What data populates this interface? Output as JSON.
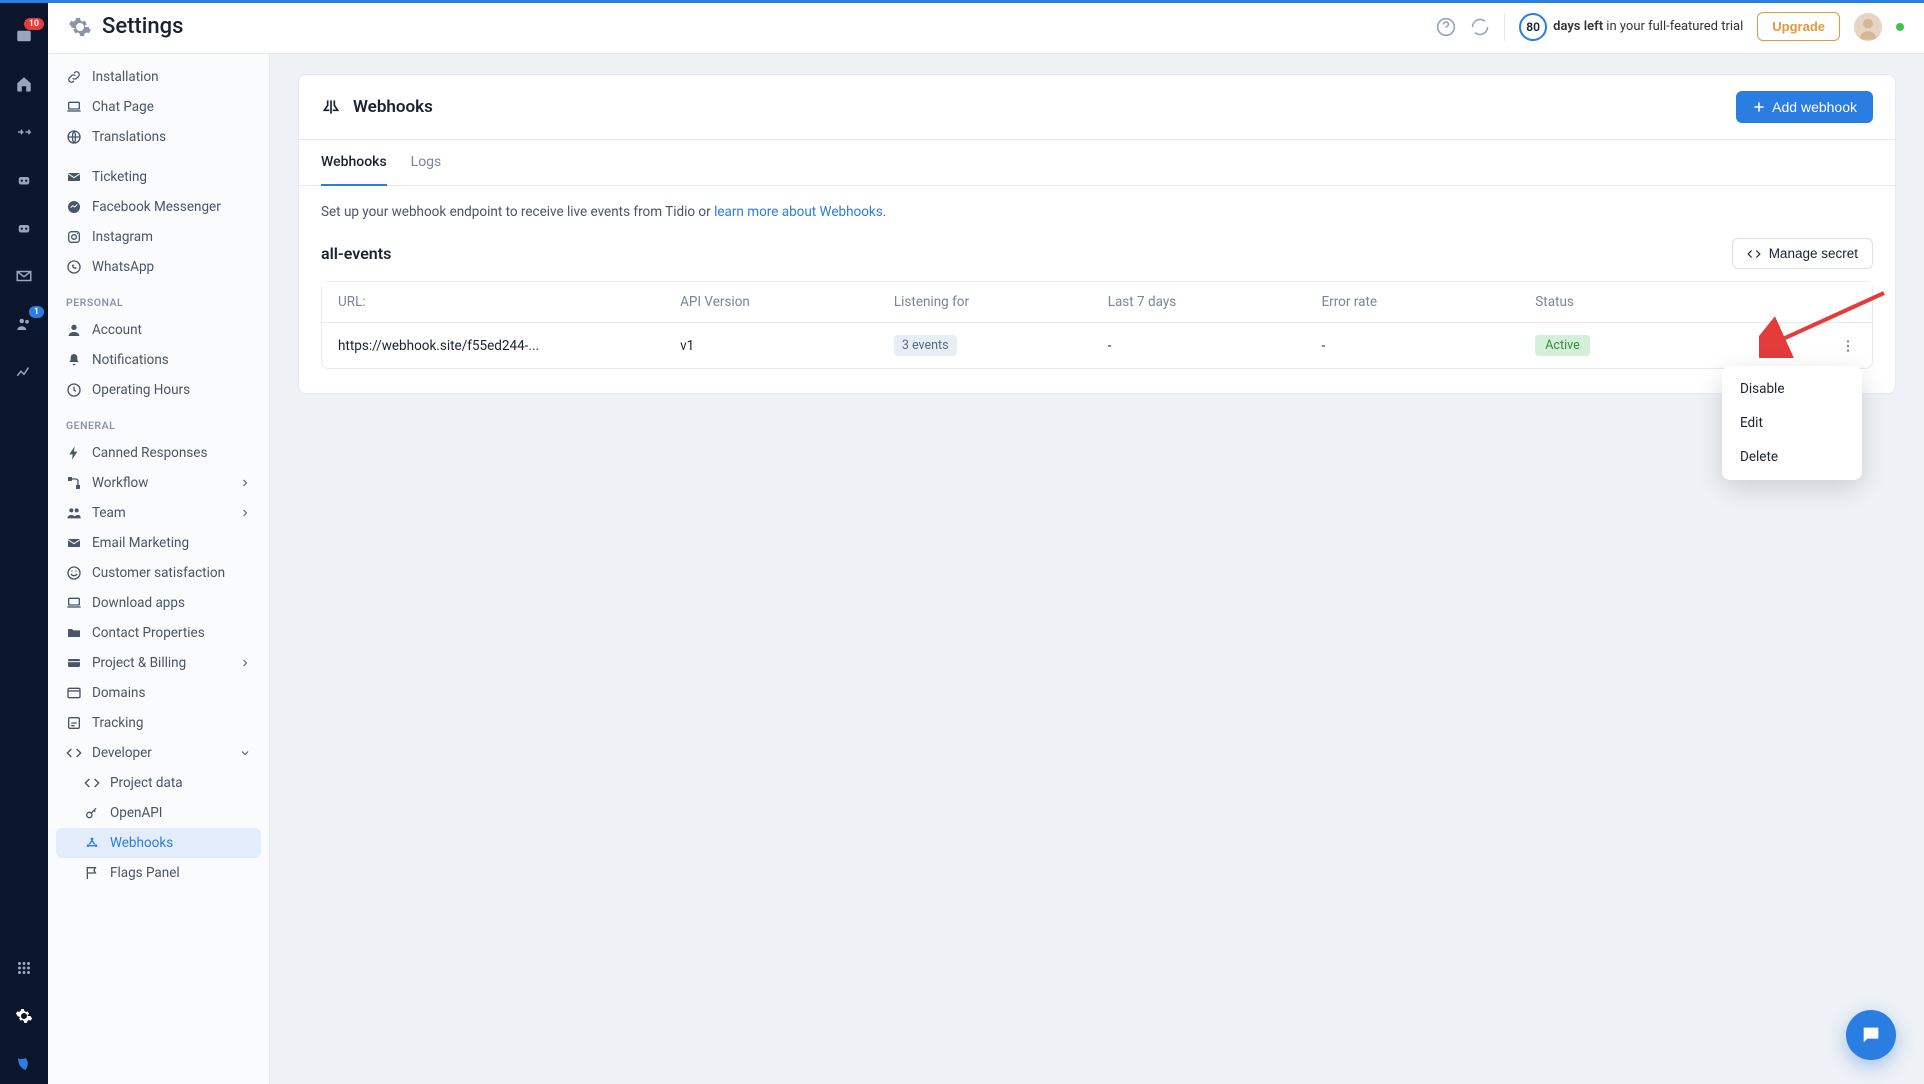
{
  "header": {
    "title": "Settings",
    "trial": {
      "days": "80",
      "text_bold": "days left",
      "text_rest": " in your full-featured trial"
    },
    "upgrade_label": "Upgrade"
  },
  "rail": {
    "badge_inbox": "10",
    "badge_team": "1"
  },
  "sidebar": {
    "items": [
      {
        "label": "Installation",
        "icon": "link"
      },
      {
        "label": "Chat Page",
        "icon": "laptop"
      },
      {
        "label": "Translations",
        "icon": "globe"
      }
    ],
    "channels": [
      {
        "label": "Ticketing",
        "icon": "mail"
      },
      {
        "label": "Facebook Messenger",
        "icon": "messenger"
      },
      {
        "label": "Instagram",
        "icon": "instagram"
      },
      {
        "label": "WhatsApp",
        "icon": "whatsapp"
      }
    ],
    "personal_label": "PERSONAL",
    "personal": [
      {
        "label": "Account",
        "icon": "user"
      },
      {
        "label": "Notifications",
        "icon": "bell"
      },
      {
        "label": "Operating Hours",
        "icon": "clock"
      }
    ],
    "general_label": "GENERAL",
    "general": [
      {
        "label": "Canned Responses",
        "icon": "bolt"
      },
      {
        "label": "Workflow",
        "icon": "workflow",
        "chevron": true
      },
      {
        "label": "Team",
        "icon": "team",
        "chevron": true
      },
      {
        "label": "Email Marketing",
        "icon": "mail"
      },
      {
        "label": "Customer satisfaction",
        "icon": "smile"
      },
      {
        "label": "Download apps",
        "icon": "laptop"
      },
      {
        "label": "Contact Properties",
        "icon": "folder"
      },
      {
        "label": "Project & Billing",
        "icon": "billing",
        "chevron": true
      },
      {
        "label": "Domains",
        "icon": "domains"
      },
      {
        "label": "Tracking",
        "icon": "tracking"
      },
      {
        "label": "Developer",
        "icon": "code",
        "chevron_down": true
      }
    ],
    "developer_sub": [
      {
        "label": "Project data",
        "icon": "code"
      },
      {
        "label": "OpenAPI",
        "icon": "key"
      },
      {
        "label": "Webhooks",
        "icon": "webhook",
        "active": true
      }
    ],
    "flags": {
      "label": "Flags Panel",
      "icon": "flags"
    }
  },
  "page": {
    "title": "Webhooks",
    "add_button": "Add webhook",
    "tabs": [
      {
        "label": "Webhooks",
        "active": true
      },
      {
        "label": "Logs",
        "active": false
      }
    ],
    "intro_prefix": "Set up your webhook endpoint to receive live events from Tidio or ",
    "intro_link": "learn more about Webhooks",
    "section_name": "all-events",
    "manage_secret_label": "Manage secret",
    "table": {
      "headers": [
        "URL:",
        "API Version",
        "Listening for",
        "Last 7 days",
        "Error rate",
        "Status",
        ""
      ],
      "rows": [
        {
          "url": "https://webhook.site/f55ed244-...",
          "api_version": "v1",
          "listening": "3 events",
          "last7": "-",
          "error_rate": "-",
          "status": "Active"
        }
      ]
    },
    "dropdown": [
      "Disable",
      "Edit",
      "Delete"
    ]
  }
}
